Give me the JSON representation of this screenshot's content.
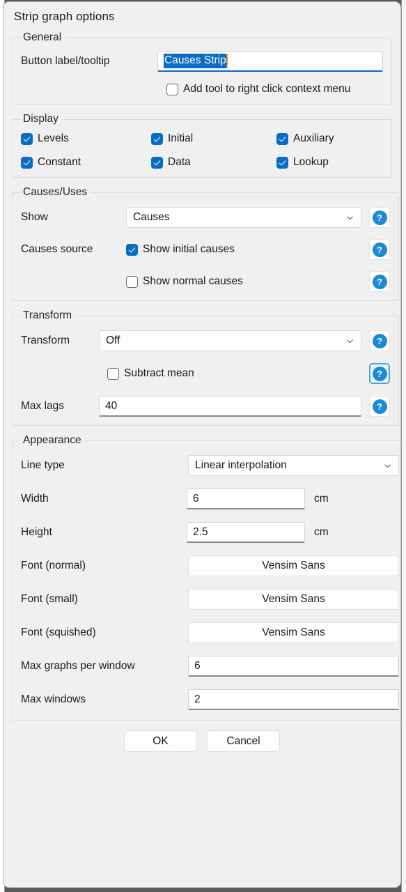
{
  "window": {
    "title": "Strip graph options"
  },
  "general": {
    "legend": "General",
    "button_label": {
      "label": "Button label/tooltip",
      "value": "Causes Strip",
      "selected": true
    },
    "context_menu": {
      "label": "Add tool to right click context menu",
      "checked": false
    }
  },
  "display": {
    "legend": "Display",
    "items": [
      {
        "label": "Levels",
        "checked": true
      },
      {
        "label": "Initial",
        "checked": true
      },
      {
        "label": "Auxiliary",
        "checked": true
      },
      {
        "label": "Constant",
        "checked": true
      },
      {
        "label": "Data",
        "checked": true
      },
      {
        "label": "Lookup",
        "checked": true
      }
    ]
  },
  "causes_uses": {
    "legend": "Causes/Uses",
    "show": {
      "label": "Show",
      "value": "Causes"
    },
    "causes_source": {
      "label": "Causes source"
    },
    "show_initial": {
      "label": "Show initial causes",
      "checked": true
    },
    "show_normal": {
      "label": "Show normal causes",
      "checked": false
    }
  },
  "transform": {
    "legend": "Transform",
    "transform": {
      "label": "Transform",
      "value": "Off"
    },
    "subtract_mean": {
      "label": "Subtract mean",
      "checked": false
    },
    "max_lags": {
      "label": "Max lags",
      "value": "40"
    }
  },
  "appearance": {
    "legend": "Appearance",
    "line_type": {
      "label": "Line type",
      "value": "Linear interpolation"
    },
    "width": {
      "label": "Width",
      "value": "6",
      "unit": "cm"
    },
    "height": {
      "label": "Height",
      "value": "2.5",
      "unit": "cm"
    },
    "font_normal": {
      "label": "Font (normal)",
      "value": "Vensim Sans"
    },
    "font_small": {
      "label": "Font (small)",
      "value": "Vensim Sans"
    },
    "font_squished": {
      "label": "Font (squished)",
      "value": "Vensim Sans"
    },
    "max_graphs": {
      "label": "Max graphs per window",
      "value": "6"
    },
    "max_windows": {
      "label": "Max windows",
      "value": "2"
    }
  },
  "footer": {
    "ok": "OK",
    "cancel": "Cancel"
  },
  "icons": {
    "help": "?"
  },
  "colors": {
    "accent": "#0a6cc4",
    "help_blue": "#1b8ad6",
    "caret": "#e08a2e"
  }
}
